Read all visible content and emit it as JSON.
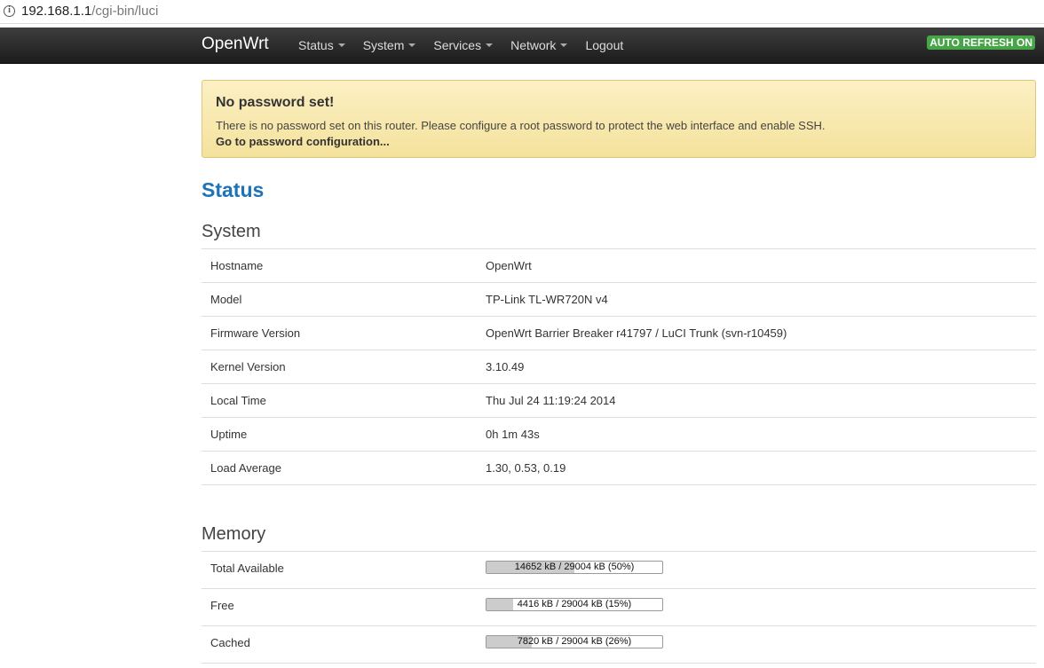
{
  "browser": {
    "url_host": "192.168.1.1",
    "url_path": "/cgi-bin/luci",
    "info_icon": "info-icon"
  },
  "navbar": {
    "brand": "OpenWrt",
    "menu": [
      {
        "label": "Status",
        "dropdown": true
      },
      {
        "label": "System",
        "dropdown": true
      },
      {
        "label": "Services",
        "dropdown": true
      },
      {
        "label": "Network",
        "dropdown": true
      },
      {
        "label": "Logout",
        "dropdown": false
      }
    ],
    "auto_refresh": "AUTO REFRESH ON",
    "colors": {
      "badge": "#46a546"
    }
  },
  "alert": {
    "title": "No password set!",
    "text": "There is no password set on this router. Please configure a root password to protect the web interface and enable SSH.",
    "link": "Go to password configuration..."
  },
  "page": {
    "title": "Status"
  },
  "system": {
    "heading": "System",
    "rows": [
      {
        "key": "Hostname",
        "value": "OpenWrt"
      },
      {
        "key": "Model",
        "value": "TP-Link TL-WR720N v4"
      },
      {
        "key": "Firmware Version",
        "value": "OpenWrt Barrier Breaker r41797 / LuCI Trunk (svn-r10459)"
      },
      {
        "key": "Kernel Version",
        "value": "3.10.49"
      },
      {
        "key": "Local Time",
        "value": "Thu Jul 24 11:19:24 2014"
      },
      {
        "key": "Uptime",
        "value": "0h 1m 43s"
      },
      {
        "key": "Load Average",
        "value": "1.30, 0.53, 0.19"
      }
    ]
  },
  "memory": {
    "heading": "Memory",
    "rows": [
      {
        "key": "Total Available",
        "label": "14652 kB / 29004 kB (50%)",
        "percent": 50
      },
      {
        "key": "Free",
        "label": "4416 kB / 29004 kB (15%)",
        "percent": 15
      },
      {
        "key": "Cached",
        "label": "7820 kB / 29004 kB (26%)",
        "percent": 26
      }
    ]
  }
}
